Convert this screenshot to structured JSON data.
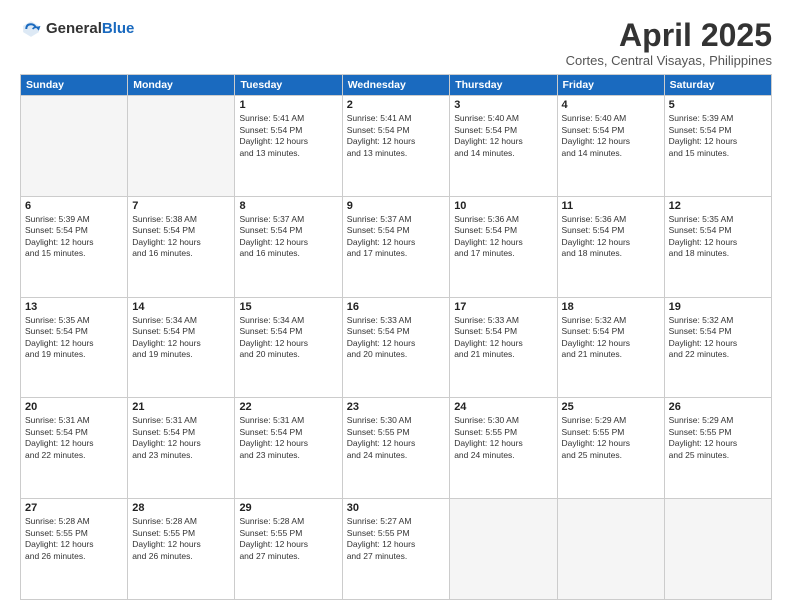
{
  "header": {
    "logo_general": "General",
    "logo_blue": "Blue",
    "month_title": "April 2025",
    "location": "Cortes, Central Visayas, Philippines"
  },
  "weekdays": [
    "Sunday",
    "Monday",
    "Tuesday",
    "Wednesday",
    "Thursday",
    "Friday",
    "Saturday"
  ],
  "weeks": [
    [
      {
        "day": "",
        "info": ""
      },
      {
        "day": "",
        "info": ""
      },
      {
        "day": "1",
        "info": "Sunrise: 5:41 AM\nSunset: 5:54 PM\nDaylight: 12 hours\nand 13 minutes."
      },
      {
        "day": "2",
        "info": "Sunrise: 5:41 AM\nSunset: 5:54 PM\nDaylight: 12 hours\nand 13 minutes."
      },
      {
        "day": "3",
        "info": "Sunrise: 5:40 AM\nSunset: 5:54 PM\nDaylight: 12 hours\nand 14 minutes."
      },
      {
        "day": "4",
        "info": "Sunrise: 5:40 AM\nSunset: 5:54 PM\nDaylight: 12 hours\nand 14 minutes."
      },
      {
        "day": "5",
        "info": "Sunrise: 5:39 AM\nSunset: 5:54 PM\nDaylight: 12 hours\nand 15 minutes."
      }
    ],
    [
      {
        "day": "6",
        "info": "Sunrise: 5:39 AM\nSunset: 5:54 PM\nDaylight: 12 hours\nand 15 minutes."
      },
      {
        "day": "7",
        "info": "Sunrise: 5:38 AM\nSunset: 5:54 PM\nDaylight: 12 hours\nand 16 minutes."
      },
      {
        "day": "8",
        "info": "Sunrise: 5:37 AM\nSunset: 5:54 PM\nDaylight: 12 hours\nand 16 minutes."
      },
      {
        "day": "9",
        "info": "Sunrise: 5:37 AM\nSunset: 5:54 PM\nDaylight: 12 hours\nand 17 minutes."
      },
      {
        "day": "10",
        "info": "Sunrise: 5:36 AM\nSunset: 5:54 PM\nDaylight: 12 hours\nand 17 minutes."
      },
      {
        "day": "11",
        "info": "Sunrise: 5:36 AM\nSunset: 5:54 PM\nDaylight: 12 hours\nand 18 minutes."
      },
      {
        "day": "12",
        "info": "Sunrise: 5:35 AM\nSunset: 5:54 PM\nDaylight: 12 hours\nand 18 minutes."
      }
    ],
    [
      {
        "day": "13",
        "info": "Sunrise: 5:35 AM\nSunset: 5:54 PM\nDaylight: 12 hours\nand 19 minutes."
      },
      {
        "day": "14",
        "info": "Sunrise: 5:34 AM\nSunset: 5:54 PM\nDaylight: 12 hours\nand 19 minutes."
      },
      {
        "day": "15",
        "info": "Sunrise: 5:34 AM\nSunset: 5:54 PM\nDaylight: 12 hours\nand 20 minutes."
      },
      {
        "day": "16",
        "info": "Sunrise: 5:33 AM\nSunset: 5:54 PM\nDaylight: 12 hours\nand 20 minutes."
      },
      {
        "day": "17",
        "info": "Sunrise: 5:33 AM\nSunset: 5:54 PM\nDaylight: 12 hours\nand 21 minutes."
      },
      {
        "day": "18",
        "info": "Sunrise: 5:32 AM\nSunset: 5:54 PM\nDaylight: 12 hours\nand 21 minutes."
      },
      {
        "day": "19",
        "info": "Sunrise: 5:32 AM\nSunset: 5:54 PM\nDaylight: 12 hours\nand 22 minutes."
      }
    ],
    [
      {
        "day": "20",
        "info": "Sunrise: 5:31 AM\nSunset: 5:54 PM\nDaylight: 12 hours\nand 22 minutes."
      },
      {
        "day": "21",
        "info": "Sunrise: 5:31 AM\nSunset: 5:54 PM\nDaylight: 12 hours\nand 23 minutes."
      },
      {
        "day": "22",
        "info": "Sunrise: 5:31 AM\nSunset: 5:54 PM\nDaylight: 12 hours\nand 23 minutes."
      },
      {
        "day": "23",
        "info": "Sunrise: 5:30 AM\nSunset: 5:55 PM\nDaylight: 12 hours\nand 24 minutes."
      },
      {
        "day": "24",
        "info": "Sunrise: 5:30 AM\nSunset: 5:55 PM\nDaylight: 12 hours\nand 24 minutes."
      },
      {
        "day": "25",
        "info": "Sunrise: 5:29 AM\nSunset: 5:55 PM\nDaylight: 12 hours\nand 25 minutes."
      },
      {
        "day": "26",
        "info": "Sunrise: 5:29 AM\nSunset: 5:55 PM\nDaylight: 12 hours\nand 25 minutes."
      }
    ],
    [
      {
        "day": "27",
        "info": "Sunrise: 5:28 AM\nSunset: 5:55 PM\nDaylight: 12 hours\nand 26 minutes."
      },
      {
        "day": "28",
        "info": "Sunrise: 5:28 AM\nSunset: 5:55 PM\nDaylight: 12 hours\nand 26 minutes."
      },
      {
        "day": "29",
        "info": "Sunrise: 5:28 AM\nSunset: 5:55 PM\nDaylight: 12 hours\nand 27 minutes."
      },
      {
        "day": "30",
        "info": "Sunrise: 5:27 AM\nSunset: 5:55 PM\nDaylight: 12 hours\nand 27 minutes."
      },
      {
        "day": "",
        "info": ""
      },
      {
        "day": "",
        "info": ""
      },
      {
        "day": "",
        "info": ""
      }
    ]
  ]
}
